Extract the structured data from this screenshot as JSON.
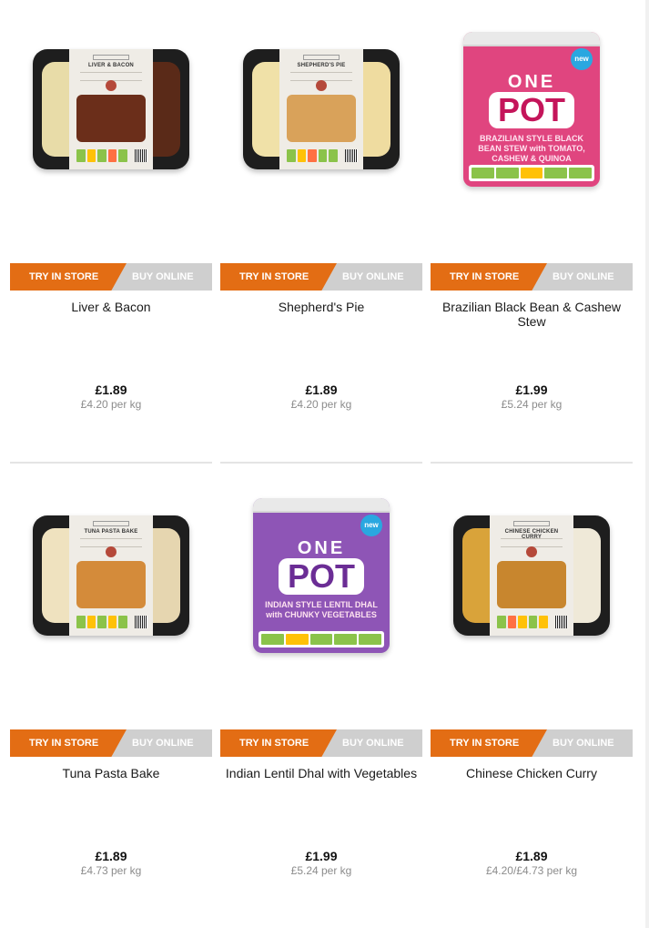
{
  "products": [
    {
      "name": "Liver & Bacon",
      "price": "£1.89",
      "unit_price": "£4.20 per kg",
      "pack_label": "LIVER & BACON",
      "try_label": "TRY IN STORE",
      "buy_label": "BUY ONLINE",
      "image_kind": "tray",
      "colors": {
        "left": "#e8dca8",
        "right": "#5a2a18",
        "photo": "#6b2e1a"
      }
    },
    {
      "name": "Shepherd's Pie",
      "price": "£1.89",
      "unit_price": "£4.20 per kg",
      "pack_label": "SHEPHERD'S PIE",
      "try_label": "TRY IN STORE",
      "buy_label": "BUY ONLINE",
      "image_kind": "tray",
      "colors": {
        "left": "#f0e1a8",
        "right": "#efdca0",
        "photo": "#d9a25a"
      }
    },
    {
      "name": "Brazilian Black Bean & Cashew Stew",
      "price": "£1.99",
      "unit_price": "£5.24 per kg",
      "pot_top": "ONE",
      "pot_word": "POT",
      "pot_desc": "BRAZILIAN STYLE BLACK BEAN STEW with TOMATO, CASHEW & QUINOA",
      "new_badge": "new",
      "try_label": "TRY IN STORE",
      "buy_label": "BUY ONLINE",
      "image_kind": "pot",
      "colors": {
        "tub": "#e0457f",
        "word": "#c4155a"
      }
    },
    {
      "name": "Tuna Pasta Bake",
      "price": "£1.89",
      "unit_price": "£4.73 per kg",
      "pack_label": "TUNA PASTA BAKE",
      "try_label": "TRY IN STORE",
      "buy_label": "BUY ONLINE",
      "image_kind": "tray",
      "colors": {
        "left": "#efe2bf",
        "right": "#e6d6b0",
        "photo": "#d48b3a"
      }
    },
    {
      "name": "Indian Lentil Dhal with Vegetables",
      "price": "£1.99",
      "unit_price": "£5.24 per kg",
      "pot_top": "ONE",
      "pot_word": "POT",
      "pot_desc": "INDIAN STYLE LENTIL DHAL with CHUNKY VEGETABLES",
      "new_badge": "new",
      "try_label": "TRY IN STORE",
      "buy_label": "BUY ONLINE",
      "image_kind": "pot",
      "colors": {
        "tub": "#8e55b6",
        "word": "#6b2d95"
      }
    },
    {
      "name": "Chinese Chicken Curry",
      "price": "£1.89",
      "unit_price": "£4.20/£4.73 per kg",
      "pack_label": "CHINESE CHICKEN CURRY",
      "try_label": "TRY IN STORE",
      "buy_label": "BUY ONLINE",
      "image_kind": "tray",
      "colors": {
        "left": "#d9a33a",
        "right": "#efe9d8",
        "photo": "#c8862e"
      }
    }
  ]
}
